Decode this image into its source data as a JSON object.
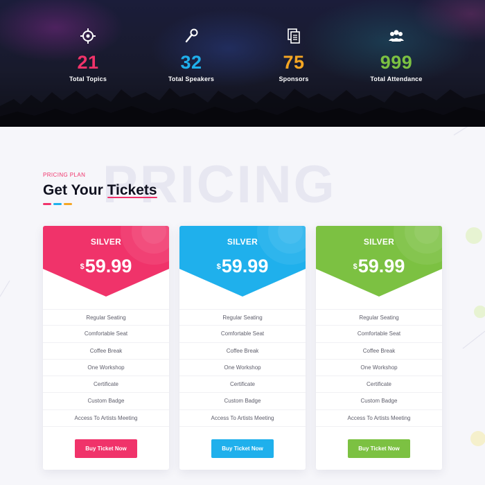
{
  "stats": [
    {
      "icon": "target-icon",
      "value": "21",
      "label": "Total Topics",
      "color": "#f0336a"
    },
    {
      "icon": "microphone-icon",
      "value": "32",
      "label": "Total Speakers",
      "color": "#1fb0ec"
    },
    {
      "icon": "document-icon",
      "value": "75",
      "label": "Sponsors",
      "color": "#f5a623"
    },
    {
      "icon": "users-icon",
      "value": "999",
      "label": "Total Attendance",
      "color": "#7cc142"
    }
  ],
  "section": {
    "watermark": "PRICING",
    "eyebrow": "PRICING PLAN",
    "title_prefix": "Get Your ",
    "title_highlight": "Tickets",
    "dash_colors": [
      "#f0336a",
      "#1fb0ec",
      "#f5a623"
    ]
  },
  "plans": [
    {
      "name": "SILVER",
      "currency": "$",
      "price": "59.99",
      "color": "#f0336a",
      "color_dark": "#f5486f",
      "features": [
        "Regular Seating",
        "Comfortable Seat",
        "Coffee Break",
        "One Workshop",
        "Certificate",
        "Custom Badge",
        "Access To Artists Meeting"
      ],
      "button": "Buy Ticket Now"
    },
    {
      "name": "SILVER",
      "currency": "$",
      "price": "59.99",
      "color": "#1fb0ec",
      "color_dark": "#33bbf0",
      "features": [
        "Regular Seating",
        "Comfortable Seat",
        "Coffee Break",
        "One Workshop",
        "Certificate",
        "Custom Badge",
        "Access To Artists Meeting"
      ],
      "button": "Buy Ticket Now"
    },
    {
      "name": "SILVER",
      "currency": "$",
      "price": "59.99",
      "color": "#7cc142",
      "color_dark": "#8acb51",
      "features": [
        "Regular Seating",
        "Comfortable Seat",
        "Coffee Break",
        "One Workshop",
        "Certificate",
        "Custom Badge",
        "Access To Artists Meeting"
      ],
      "button": "Buy Ticket Now"
    }
  ]
}
